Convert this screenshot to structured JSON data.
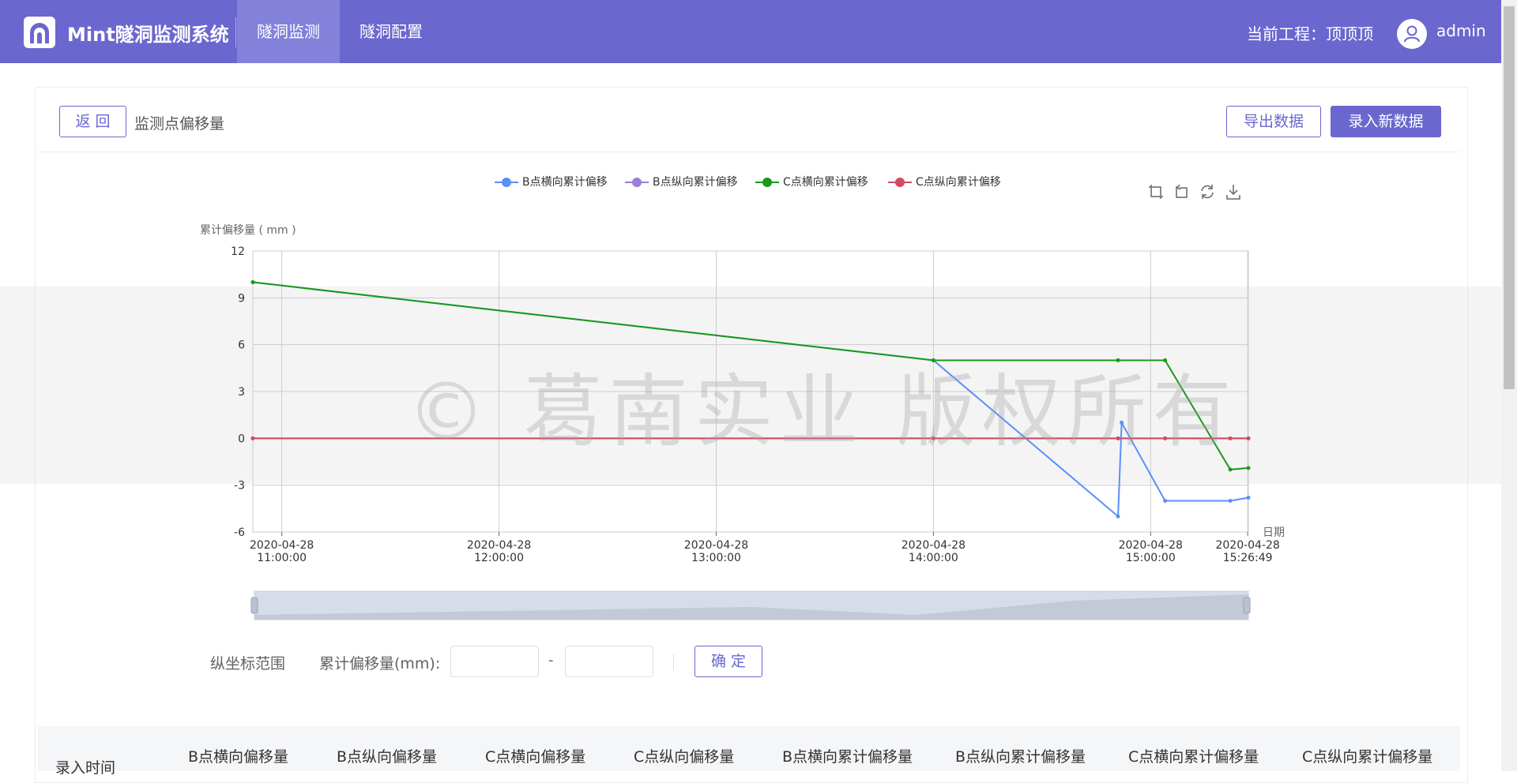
{
  "header": {
    "app_title": "Mint隧洞监测系统",
    "tabs": [
      {
        "label": "隧洞监测",
        "active": true
      },
      {
        "label": "隧洞配置",
        "active": false
      }
    ],
    "project_label": "当前工程：顶顶顶",
    "username": "admin"
  },
  "toolbar": {
    "back_label": "返 回",
    "title": "监测点偏移量",
    "export_label": "导出数据",
    "new_label": "录入新数据"
  },
  "watermark": "©  葛南实业 版权所有",
  "chart_data": {
    "type": "line",
    "ylabel": "累计偏移量 ( mm )",
    "xlabel": "日期",
    "ylim": [
      -6,
      12
    ],
    "yticks": [
      "12",
      "9",
      "6",
      "3",
      "0",
      "-3",
      "-6"
    ],
    "xticks": [
      {
        "date": "2020-04-28",
        "time": "11:00:00"
      },
      {
        "date": "2020-04-28",
        "time": "12:00:00"
      },
      {
        "date": "2020-04-28",
        "time": "13:00:00"
      },
      {
        "date": "2020-04-28",
        "time": "14:00:00"
      },
      {
        "date": "2020-04-28",
        "time": "15:00:00"
      },
      {
        "date": "2020-04-28",
        "time": "15:26:49"
      }
    ],
    "legend_position": "top-center",
    "grid": true,
    "series": [
      {
        "name": "B点横向累计偏移",
        "color": "#5b8ff9",
        "points": [
          [
            "10:52",
            10
          ],
          [
            "14:00",
            5
          ],
          [
            "14:51",
            -5
          ],
          [
            "14:52",
            1
          ],
          [
            "15:04",
            -4
          ],
          [
            "15:22",
            -4
          ],
          [
            "15:27",
            -3.8
          ]
        ]
      },
      {
        "name": "B点纵向累计偏移",
        "color": "#9a7fd6",
        "points": [
          [
            "10:52",
            0
          ],
          [
            "14:00",
            0
          ],
          [
            "14:51",
            0
          ],
          [
            "15:04",
            0
          ],
          [
            "15:22",
            0
          ],
          [
            "15:27",
            0
          ]
        ]
      },
      {
        "name": "C点横向累计偏移",
        "color": "#1a9a1a",
        "points": [
          [
            "10:52",
            10
          ],
          [
            "14:00",
            5
          ],
          [
            "14:51",
            5
          ],
          [
            "15:04",
            5
          ],
          [
            "15:22",
            -2
          ],
          [
            "15:27",
            -1.9
          ]
        ]
      },
      {
        "name": "C点纵向累计偏移",
        "color": "#d14a61",
        "points": [
          [
            "10:52",
            0
          ],
          [
            "14:00",
            0
          ],
          [
            "14:51",
            0
          ],
          [
            "15:04",
            0
          ],
          [
            "15:22",
            0
          ],
          [
            "15:27",
            0
          ]
        ]
      }
    ]
  },
  "filter": {
    "range_label": "纵坐标范围",
    "field_label": "累计偏移量(mm):",
    "min_value": "",
    "max_value": "",
    "dash": "-",
    "confirm_label": "确 定"
  },
  "table": {
    "columns": [
      "录入时间",
      "B点横向偏移量",
      "B点纵向偏移量",
      "C点横向偏移量",
      "C点纵向偏移量",
      "B点横向累计偏移量",
      "B点纵向累计偏移量",
      "C点横向累计偏移量",
      "C点纵向累计偏移量"
    ]
  }
}
